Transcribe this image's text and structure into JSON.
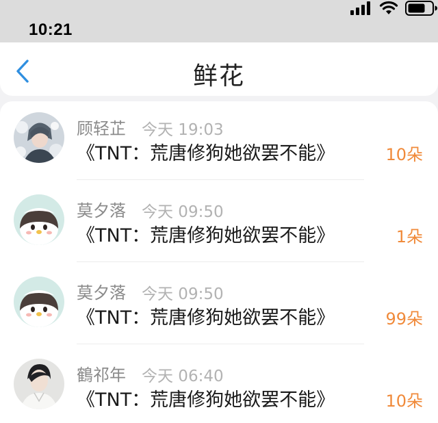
{
  "status_bar": {
    "time": "10:21"
  },
  "nav": {
    "title": "鲜花"
  },
  "colors": {
    "accent": "#2f8fe0",
    "count": "#f08a3a",
    "name": "#8a8a8a",
    "time": "#b2b2b2"
  },
  "gifts": [
    {
      "user": "顾轻芷",
      "time": "今天 19:03",
      "book": "《TNT：荒唐修狗她欲罢不能》",
      "count": "10朵",
      "avatar": "anime-boy-flowers"
    },
    {
      "user": "莫夕落",
      "time": "今天 09:50",
      "book": "《TNT：荒唐修狗她欲罢不能》",
      "count": "1朵",
      "avatar": "penguin"
    },
    {
      "user": "莫夕落",
      "time": "今天 09:50",
      "book": "《TNT：荒唐修狗她欲罢不能》",
      "count": "99朵",
      "avatar": "penguin"
    },
    {
      "user": "鶴祁年",
      "time": "今天 06:40",
      "book": "《TNT：荒唐修狗她欲罢不能》",
      "count": "10朵",
      "avatar": "man-traditional"
    }
  ]
}
